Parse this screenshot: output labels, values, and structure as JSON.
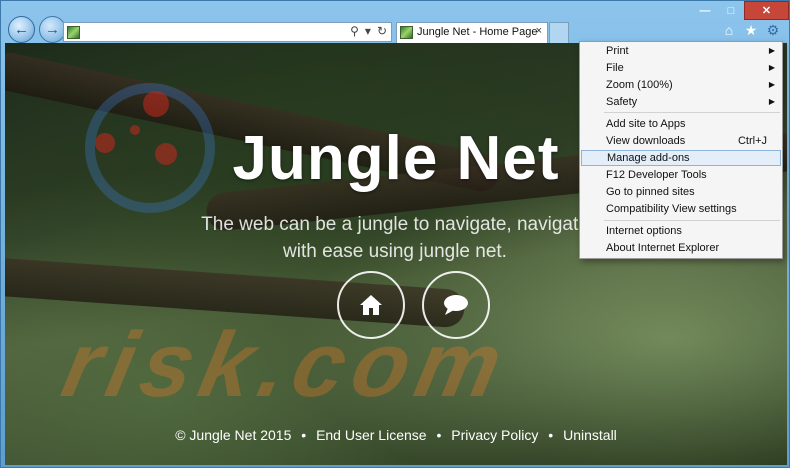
{
  "browser": {
    "address": {
      "value": "",
      "placeholder": ""
    },
    "address_icons": [
      "⚲",
      "▾",
      "↻"
    ],
    "tab": {
      "title": "Jungle Net - Home Page",
      "close": "×"
    },
    "window_controls": {
      "minimize": "—",
      "maximize": "□",
      "close": "✕"
    },
    "nav": {
      "back": "←",
      "forward": "→"
    },
    "toolbar_icons": {
      "home": "⌂",
      "favorites": "★",
      "tools": "⚙"
    }
  },
  "page": {
    "title": "Jungle Net",
    "tagline": "The web can be a jungle to navigate, navigate with ease using jungle net.",
    "watermark": "risk.com",
    "footer": {
      "copyright": "© Jungle Net 2015",
      "links": [
        "End User License",
        "Privacy Policy",
        "Uninstall"
      ],
      "separator": "•"
    }
  },
  "tools_menu": {
    "items": [
      {
        "label": "Print",
        "arrow": "▶",
        "shortcut": ""
      },
      {
        "label": "File",
        "arrow": "▶",
        "shortcut": ""
      },
      {
        "label": "Zoom (100%)",
        "arrow": "▶",
        "shortcut": ""
      },
      {
        "label": "Safety",
        "arrow": "▶",
        "shortcut": ""
      },
      {
        "label": "Add site to Apps",
        "arrow": "",
        "shortcut": ""
      },
      {
        "label": "View downloads",
        "arrow": "",
        "shortcut": "Ctrl+J"
      },
      {
        "label": "Manage add-ons",
        "arrow": "",
        "shortcut": "",
        "highlighted": true
      },
      {
        "label": "F12 Developer Tools",
        "arrow": "",
        "shortcut": ""
      },
      {
        "label": "Go to pinned sites",
        "arrow": "",
        "shortcut": ""
      },
      {
        "label": "Compatibility View settings",
        "arrow": "",
        "shortcut": ""
      },
      {
        "label": "Internet options",
        "arrow": "",
        "shortcut": ""
      },
      {
        "label": "About Internet Explorer",
        "arrow": "",
        "shortcut": ""
      }
    ]
  },
  "colors": {
    "frame": "#5d9ed0",
    "close_button": "#c7463a",
    "menu_highlight": "#e4eef9"
  }
}
